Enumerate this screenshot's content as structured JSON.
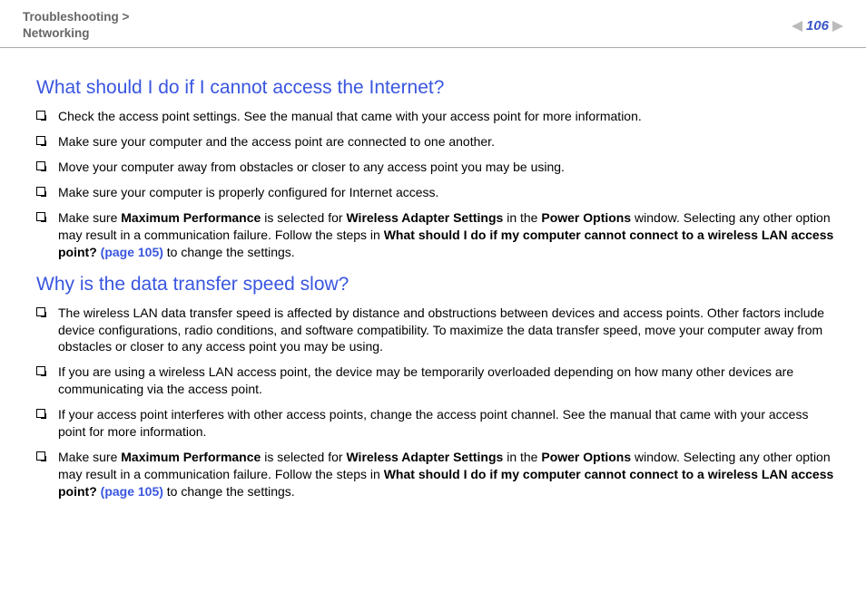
{
  "header": {
    "breadcrumb_line1": "Troubleshooting >",
    "breadcrumb_line2": "Networking",
    "page_number": "106"
  },
  "sections": [
    {
      "heading": "What should I do if I cannot access the Internet?",
      "items": [
        {
          "parts": [
            {
              "text": "Check the access point settings. See the manual that came with your access point for more information."
            }
          ]
        },
        {
          "parts": [
            {
              "text": "Make sure your computer and the access point are connected to one another."
            }
          ]
        },
        {
          "parts": [
            {
              "text": "Move your computer away from obstacles or closer to any access point you may be using."
            }
          ]
        },
        {
          "parts": [
            {
              "text": "Make sure your computer is properly configured for Internet access."
            }
          ]
        },
        {
          "parts": [
            {
              "text": "Make sure "
            },
            {
              "text": "Maximum Performance",
              "bold": true
            },
            {
              "text": " is selected for "
            },
            {
              "text": "Wireless Adapter Settings",
              "bold": true
            },
            {
              "text": " in the "
            },
            {
              "text": "Power Options",
              "bold": true
            },
            {
              "text": " window. Selecting any other option may result in a communication failure. Follow the steps in "
            },
            {
              "text": "What should I do if my computer cannot connect to a wireless LAN access point? ",
              "bold": true
            },
            {
              "text": "(page 105)",
              "link": true
            },
            {
              "text": " to change the settings."
            }
          ]
        }
      ]
    },
    {
      "heading": "Why is the data transfer speed slow?",
      "items": [
        {
          "parts": [
            {
              "text": "The wireless LAN data transfer speed is affected by distance and obstructions between devices and access points. Other factors include device configurations, radio conditions, and software compatibility. To maximize the data transfer speed, move your computer away from obstacles or closer to any access point you may be using."
            }
          ]
        },
        {
          "parts": [
            {
              "text": "If you are using a wireless LAN access point, the device may be temporarily overloaded depending on how many other devices are communicating via the access point."
            }
          ]
        },
        {
          "parts": [
            {
              "text": "If your access point interferes with other access points, change the access point channel. See the manual that came with your access point for more information."
            }
          ]
        },
        {
          "parts": [
            {
              "text": "Make sure "
            },
            {
              "text": "Maximum Performance",
              "bold": true
            },
            {
              "text": " is selected for "
            },
            {
              "text": "Wireless Adapter Settings",
              "bold": true
            },
            {
              "text": " in the "
            },
            {
              "text": "Power Options",
              "bold": true
            },
            {
              "text": " window. Selecting any other option may result in a communication failure. Follow the steps in "
            },
            {
              "text": "What should I do if my computer cannot connect to a wireless LAN access point? ",
              "bold": true
            },
            {
              "text": "(page 105)",
              "link": true
            },
            {
              "text": " to change the settings."
            }
          ]
        }
      ]
    }
  ]
}
